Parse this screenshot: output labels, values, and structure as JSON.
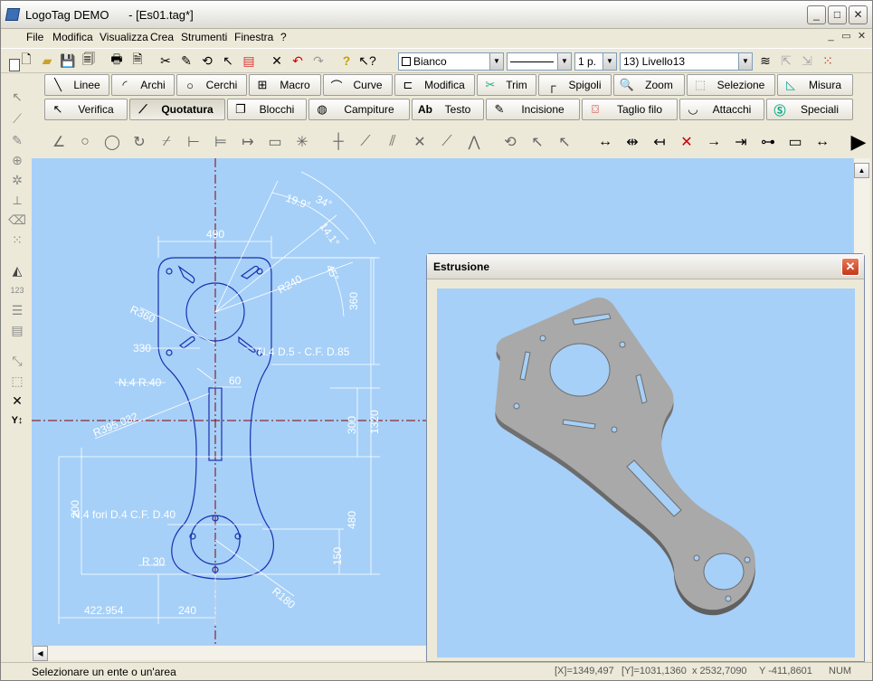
{
  "window": {
    "title": "LogoTag DEMO      - [Es01.tag*]"
  },
  "window_controls": {
    "minimize": "_",
    "maximize": "□",
    "close": "✕"
  },
  "menu": [
    "File",
    "Modifica",
    "Visualizza",
    "Crea",
    "Strumenti",
    "Finestra",
    "?"
  ],
  "toolbar": {
    "color_combo": "Bianco",
    "line_combo": "",
    "weight_combo": "1 p.",
    "layer_combo": "13) Livello13"
  },
  "command_row1": [
    "Linee",
    "Archi",
    "Cerchi",
    "Macro",
    "Curve",
    "Modifica",
    "Trim",
    "Spigoli",
    "Zoom",
    "Selezione",
    "Misura"
  ],
  "command_row2": [
    "Verifica",
    "Quotatura",
    "Blocchi",
    "Campiture",
    "Testo",
    "Incisione",
    "Taglio filo",
    "Attacchi",
    "Speciali"
  ],
  "active_command": "Quotatura",
  "drawing_labels": {
    "d490": "490",
    "a34": "34°",
    "a199": "19.9°",
    "a141": "14.1°",
    "a45": "45°",
    "r240": "R240",
    "r360": "R360",
    "d360": "360",
    "d330": "330",
    "n4d5": "N.4 D.5 - C.F. D.85",
    "n4r40": "N.4 R.40",
    "d60": "60",
    "r395": "R395.032",
    "d300": "300",
    "d1320": "1320",
    "n4fori": "N.4 fori D.4 C.F. D.40",
    "d480": "480",
    "d200": "200",
    "r30": "R 30",
    "d150": "150",
    "r180": "R180",
    "d422": "422.954",
    "d240": "240"
  },
  "extrusion_window": {
    "title": "Estrusione"
  },
  "status": {
    "message": "Selezionare un ente o un'area",
    "x": "[X]=1349,497",
    "y": "[Y]=1031,1360",
    "dx": "x 2532,7090",
    "dy": "Y -411,8601",
    "mode": "NUM"
  },
  "colors": {
    "canvas": "#a6d0f8",
    "drawing_line": "#1a2fb0",
    "dim_line": "#ffffff",
    "axis": "#8b0000",
    "part": "#a7a7a7"
  }
}
